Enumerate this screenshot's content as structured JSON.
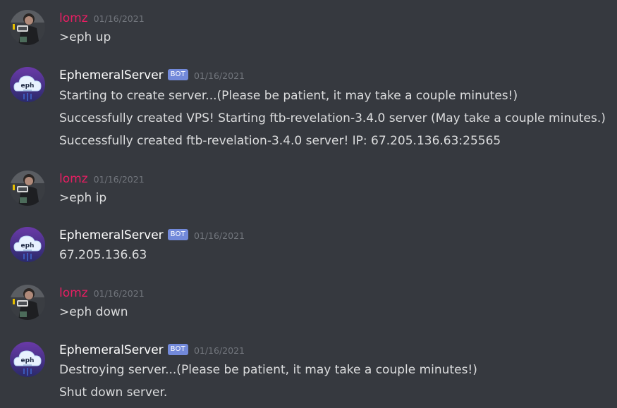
{
  "colors": {
    "background": "#36393f",
    "username_user": "#e91e63",
    "username_bot": "#ffffff",
    "bot_tag": "#7289da",
    "timestamp": "#72767d",
    "text": "#dcddde"
  },
  "messages": [
    {
      "author": "lomz",
      "timestamp": "01/16/2021",
      "avatar_icon": "user-avatar-icon",
      "lines": [
        ">eph up"
      ]
    },
    {
      "author": "EphemeralServer",
      "bot_tag": "BOT",
      "timestamp": "01/16/2021",
      "avatar_icon": "eph-cloud-avatar-icon",
      "avatar_text": "eph",
      "lines": [
        "Starting to create server...(Please be patient, it may take a couple minutes!)",
        "Successfully created VPS! Starting ftb-revelation-3.4.0 server (May take a couple minutes.)",
        "Successfully created ftb-revelation-3.4.0 server! IP: 67.205.136.63:25565"
      ]
    },
    {
      "author": "lomz",
      "timestamp": "01/16/2021",
      "avatar_icon": "user-avatar-icon",
      "lines": [
        ">eph ip"
      ]
    },
    {
      "author": "EphemeralServer",
      "bot_tag": "BOT",
      "timestamp": "01/16/2021",
      "avatar_icon": "eph-cloud-avatar-icon",
      "avatar_text": "eph",
      "lines": [
        "67.205.136.63"
      ]
    },
    {
      "author": "lomz",
      "timestamp": "01/16/2021",
      "avatar_icon": "user-avatar-icon",
      "lines": [
        ">eph down"
      ]
    },
    {
      "author": "EphemeralServer",
      "bot_tag": "BOT",
      "timestamp": "01/16/2021",
      "avatar_icon": "eph-cloud-avatar-icon",
      "avatar_text": "eph",
      "lines": [
        "Destroying server...(Please be patient, it may take a couple minutes!)",
        "Shut down server."
      ]
    }
  ]
}
